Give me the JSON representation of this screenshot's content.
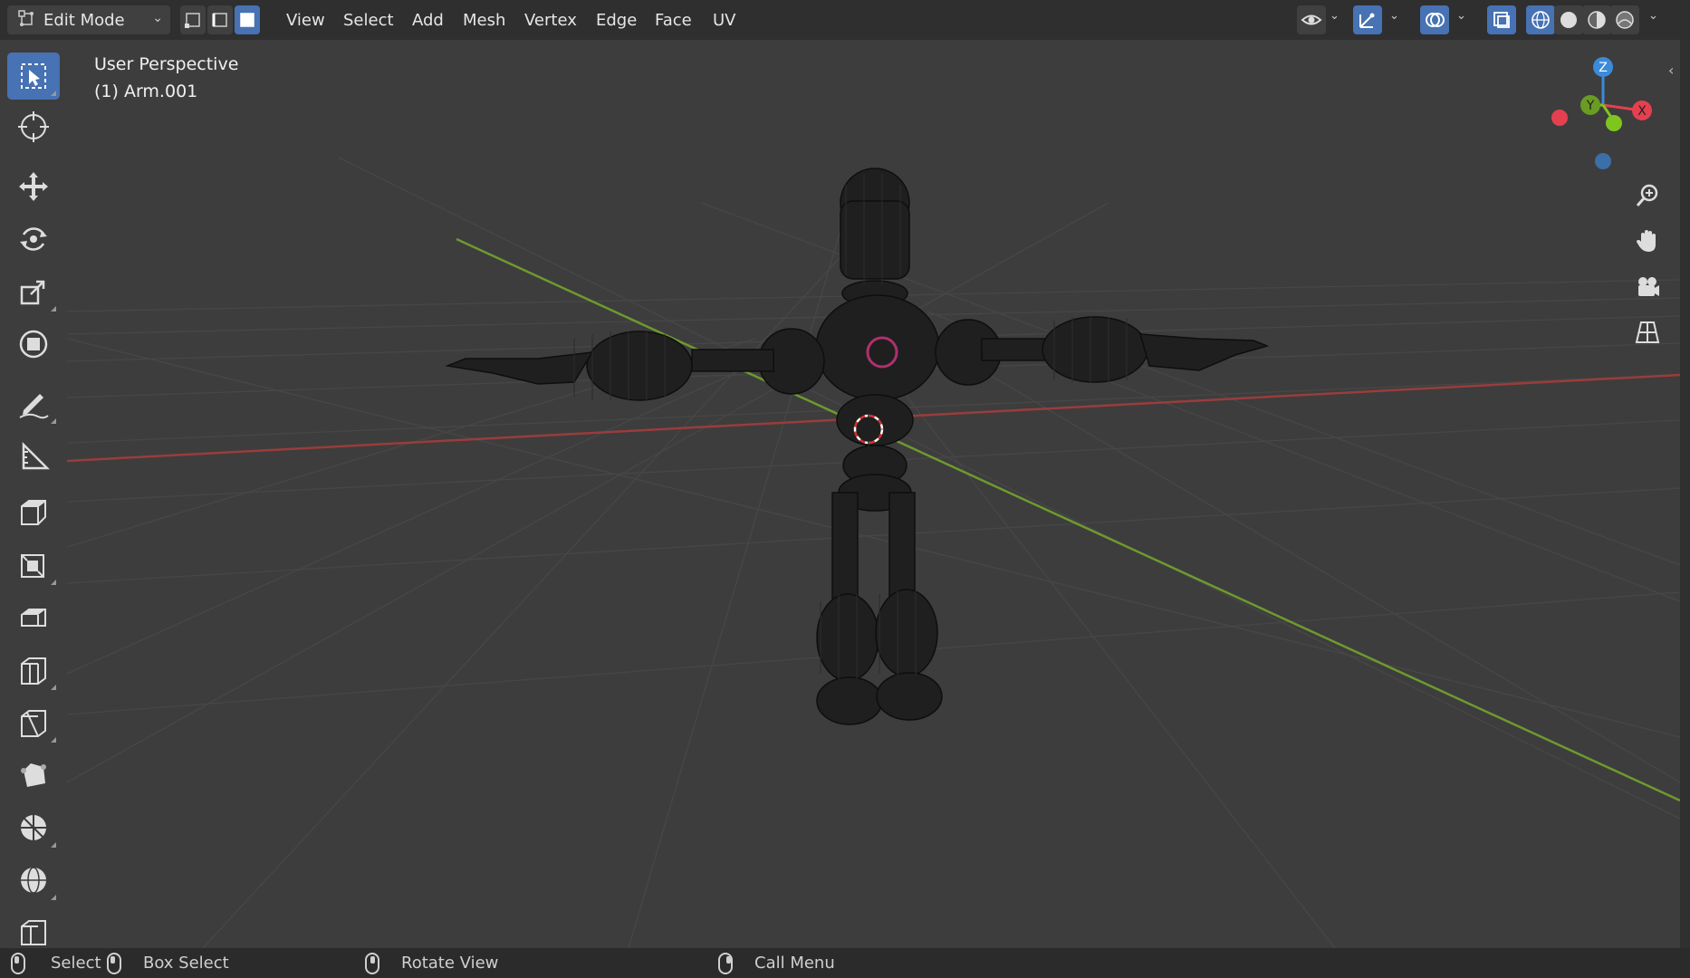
{
  "header": {
    "mode": "Edit Mode",
    "menus": [
      "View",
      "Select",
      "Add",
      "Mesh",
      "Vertex",
      "Edge",
      "Face",
      "UV"
    ]
  },
  "viewport": {
    "view_name": "User Perspective",
    "object_label": "(1) Arm.001"
  },
  "gizmo": {
    "x": "X",
    "y": "Y",
    "z": "Z"
  },
  "statusbar": {
    "select": "Select",
    "box_select": "Box Select",
    "rotate_view": "Rotate View",
    "call_menu": "Call Menu"
  },
  "colors": {
    "accent": "#4772b3",
    "x_axis": "#e5404f",
    "y_axis": "#7ec61e",
    "z_axis": "#3b8bd9"
  }
}
